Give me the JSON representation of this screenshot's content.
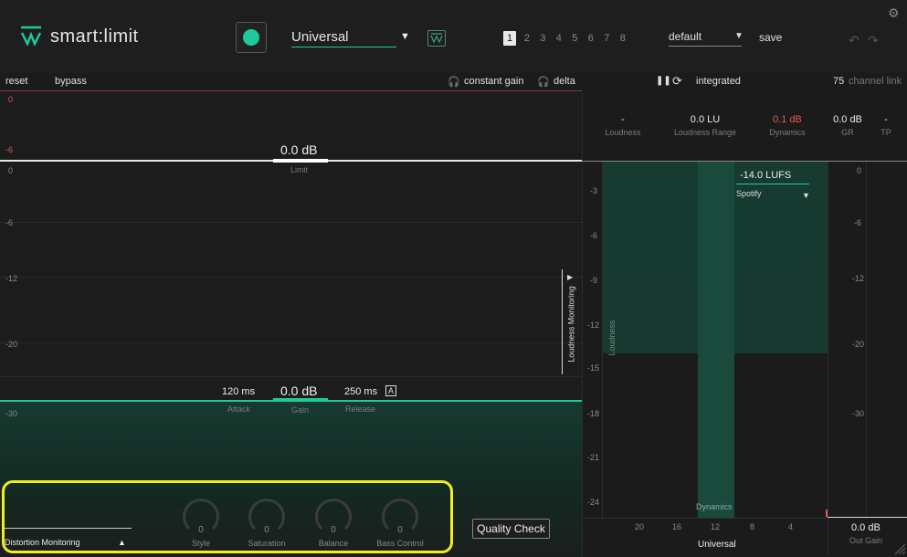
{
  "header": {
    "brand": "smart:limit",
    "profile": "Universal",
    "slots": [
      "1",
      "2",
      "3",
      "4",
      "5",
      "6",
      "7",
      "8"
    ],
    "active_slot": "1",
    "preset": "default",
    "save_label": "save"
  },
  "toolbar": {
    "reset": "reset",
    "bypass": "bypass",
    "constant_gain": "constant gain",
    "delta": "delta",
    "integrated": "integrated",
    "channel_link_value": "75",
    "channel_link": "channel link"
  },
  "limit": {
    "scale_top": [
      "0",
      "-6"
    ],
    "value": "0.0 dB",
    "label": "Limit"
  },
  "gain_scale": [
    "0",
    "-6",
    "-12",
    "-20",
    "-30"
  ],
  "gain": {
    "attack_value": "120 ms",
    "attack_label": "Attack",
    "gain_value": "0.0 dB",
    "gain_label": "Gain",
    "release_value": "250 ms",
    "release_label": "Release",
    "auto_badge": "A"
  },
  "distortion": {
    "label": "Distortion Monitoring",
    "knobs": [
      {
        "label": "Style",
        "value": "0"
      },
      {
        "label": "Saturation",
        "value": "0"
      },
      {
        "label": "Balance",
        "value": "0"
      },
      {
        "label": "Bass Control",
        "value": "0"
      }
    ]
  },
  "quality_check": "Quality Check",
  "loudness_monitoring": "Loudness Monitoring",
  "meters": [
    {
      "value": "-",
      "label": "Loudness"
    },
    {
      "value": "0.0 LU",
      "label": "Loudness Range"
    },
    {
      "value": "0.1 dB",
      "label": "Dynamics"
    },
    {
      "value": "0.0 dB",
      "label": "GR"
    },
    {
      "value": "-",
      "label": "TP"
    }
  ],
  "loudness_graph": {
    "y_ticks": [
      "-3",
      "-6",
      "-9",
      "-12",
      "-15",
      "-18",
      "-21",
      "-24"
    ],
    "x_ticks": [
      "20",
      "16",
      "12",
      "8",
      "4"
    ],
    "target": "-14.0 LUFS",
    "platform": "Spotify",
    "loudness_label": "Loudness",
    "dynamics_label": "Dynamics",
    "profile_label": "Universal"
  },
  "out_gain": {
    "scale": [
      "0",
      "-6",
      "-12",
      "-20",
      "-30"
    ],
    "value": "0.0 dB",
    "label": "Out Gain"
  },
  "colors": {
    "accent": "#1fc99c",
    "warn": "#e05a4f",
    "highlight": "#f2ee1a"
  }
}
